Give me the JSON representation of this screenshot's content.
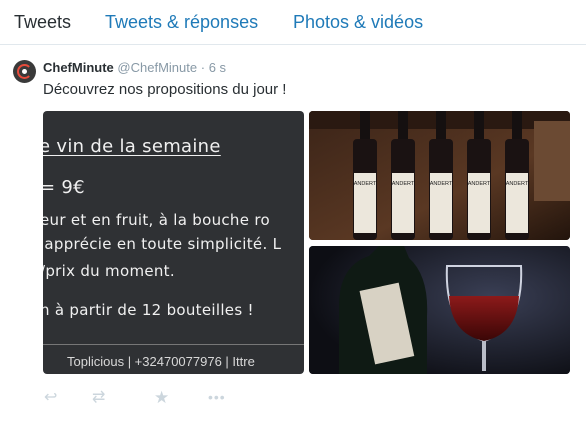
{
  "tabs": [
    {
      "label": "Tweets"
    },
    {
      "label": "Tweets & réponses"
    },
    {
      "label": "Photos & vidéos"
    }
  ],
  "tweet": {
    "author_name": "ChefMinute",
    "author_handle": "@ChefMinute",
    "separator": "·",
    "time": "6 s",
    "text": "Découvrez nos propositions du jour !"
  },
  "chalkboard": {
    "lines": [
      "e vin de la semaine",
      "= 9€",
      "eur et en fruit, à la bouche ro",
      "'apprécie en toute simplicité. L",
      "/prix du moment.",
      "n à partir de 12 bouteilles !"
    ],
    "footer": "Toplicious | +32470077976 | Ittre"
  },
  "bottle_label": "ANDERT",
  "actions": {
    "reply_icon": "reply-icon",
    "retweet_icon": "retweet-icon",
    "favorite_icon": "favorite-icon",
    "more_icon": "more-icon",
    "reply_glyph": "↩",
    "retweet_glyph": "⇄",
    "favorite_glyph": "★",
    "more_glyph": "•••"
  }
}
